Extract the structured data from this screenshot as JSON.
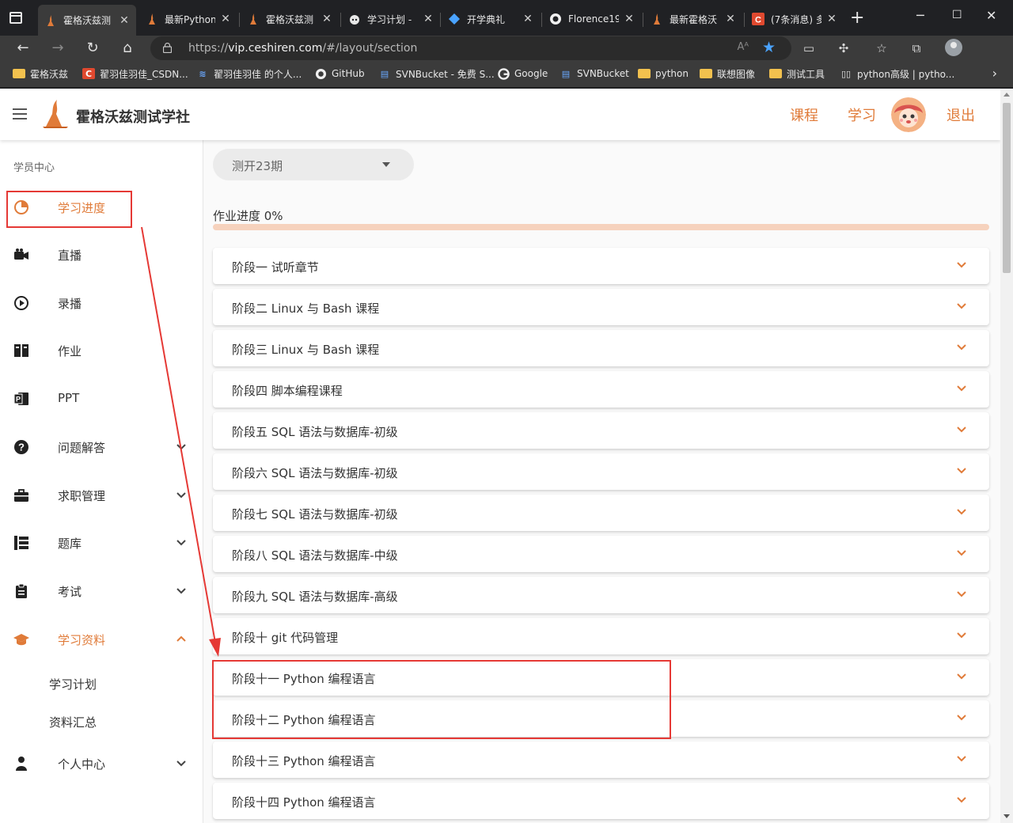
{
  "browser": {
    "tabs": [
      {
        "title": "霍格沃兹测",
        "icon": "flame-icon"
      },
      {
        "title": "最新Python",
        "icon": "flame-icon"
      },
      {
        "title": "霍格沃兹测",
        "icon": "flame-icon"
      },
      {
        "title": "学习计划 -",
        "icon": "bot-icon"
      },
      {
        "title": "开学典礼",
        "icon": "diamond-icon"
      },
      {
        "title": "Florence19",
        "icon": "github-icon"
      },
      {
        "title": "最新霍格沃",
        "icon": "flame-icon"
      },
      {
        "title": "(7条消息) 多",
        "icon": "csdn-icon"
      }
    ],
    "close_glyph": "✕",
    "address": {
      "prefix": "https://",
      "host": "vip.ceshiren.com",
      "path": "/#/layout/section"
    },
    "read_aloud": "Aᴬ",
    "bookmarks": [
      {
        "label": "霍格沃兹",
        "icon": "folder-icon"
      },
      {
        "label": "翟羽佳羽佳_CSDN...",
        "icon": "csdn-icon"
      },
      {
        "label": "翟羽佳羽佳 的个人...",
        "icon": "layers-icon"
      },
      {
        "label": "GitHub",
        "icon": "github-icon"
      },
      {
        "label": "SVNBucket - 免费 S...",
        "icon": "svn-icon"
      },
      {
        "label": "Google",
        "icon": "google-icon"
      },
      {
        "label": "SVNBucket",
        "icon": "svn-icon"
      },
      {
        "label": "python",
        "icon": "folder-icon"
      },
      {
        "label": "联想图像",
        "icon": "folder-icon"
      },
      {
        "label": "测试工具",
        "icon": "folder-icon"
      },
      {
        "label": "python高级 | pytho...",
        "icon": "book-icon"
      }
    ]
  },
  "header": {
    "brand": "霍格沃兹测试学社",
    "nav": {
      "courses": "课程",
      "learn": "学习",
      "logout": "退出"
    }
  },
  "sidebar": {
    "title": "学员中心",
    "items": [
      {
        "label": "学习进度",
        "icon": "progress-pie-icon",
        "active": true,
        "expandable": false
      },
      {
        "label": "直播",
        "icon": "video-camera-icon",
        "active": false,
        "expandable": false
      },
      {
        "label": "录播",
        "icon": "play-circle-icon",
        "active": false,
        "expandable": false
      },
      {
        "label": "作业",
        "icon": "homework-book-icon",
        "active": false,
        "expandable": false
      },
      {
        "label": "PPT",
        "icon": "ppt-icon",
        "active": false,
        "expandable": false
      },
      {
        "label": "问题解答",
        "icon": "question-circle-icon",
        "active": false,
        "expandable": true
      },
      {
        "label": "求职管理",
        "icon": "briefcase-icon",
        "active": false,
        "expandable": true
      },
      {
        "label": "题库",
        "icon": "question-bank-icon",
        "active": false,
        "expandable": true
      },
      {
        "label": "考试",
        "icon": "clipboard-icon",
        "active": false,
        "expandable": true
      },
      {
        "label": "学习资料",
        "icon": "graduation-cap-icon",
        "active": true,
        "expandable": true,
        "expanded": true
      },
      {
        "label": "个人中心",
        "icon": "person-icon",
        "active": false,
        "expandable": true
      }
    ],
    "subitems": [
      {
        "label": "学习计划"
      },
      {
        "label": "资料汇总"
      }
    ]
  },
  "main": {
    "term_select": "测开23期",
    "progress": {
      "label": "作业进度 0%",
      "percent": 0
    },
    "stages": [
      "阶段一 试听章节",
      "阶段二 Linux 与 Bash 课程",
      "阶段三 Linux 与 Bash 课程",
      "阶段四 脚本编程课程",
      "阶段五 SQL 语法与数据库-初级",
      "阶段六 SQL 语法与数据库-初级",
      "阶段七 SQL 语法与数据库-初级",
      "阶段八 SQL 语法与数据库-中级",
      "阶段九 SQL 语法与数据库-高级",
      "阶段十 git 代码管理",
      "阶段十一 Python 编程语言",
      "阶段十二 Python 编程语言",
      "阶段十三 Python 编程语言",
      "阶段十四 Python 编程语言"
    ]
  },
  "colors": {
    "accent": "#e07b39",
    "annotation": "#e53935",
    "progress_track": "#f6d2bd"
  }
}
